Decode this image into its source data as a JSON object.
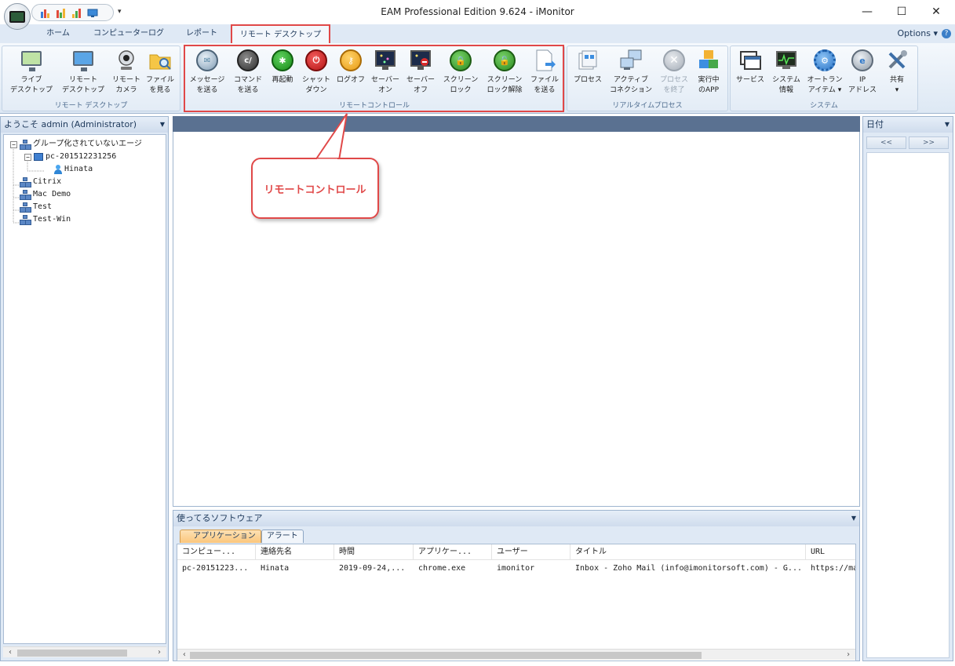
{
  "window": {
    "title": "EAM Professional Edition 9.624 - iMonitor",
    "minimize": "—",
    "maximize": "☐",
    "close": "✕"
  },
  "ribbon_tabs": [
    "ホーム",
    "コンピューターログ",
    "レポート",
    "リモート デスクトップ"
  ],
  "options_label": "Options",
  "help_label": "?",
  "groups": {
    "remote_desktop": {
      "label": "リモート デスクトップ",
      "buttons": [
        "ライブ\nデスクトップ",
        "リモート\nデスクトップ",
        "リモート\nカメラ",
        "ファイル\nを見る"
      ]
    },
    "remote_control": {
      "label": "リモートコントロール",
      "buttons": [
        "メッセージ\nを送る",
        "コマンド\nを送る",
        "再起動",
        "シャット\nダウン",
        "ログオフ",
        "セーバー\nオン",
        "セーバー\nオフ",
        "スクリーン\nロック",
        "スクリーン\nロック解除",
        "ファイル\nを送る"
      ]
    },
    "realtime_process": {
      "label": "リアルタイムプロセス",
      "buttons": [
        "プロセス",
        "アクティブ\nコネクション",
        "プロセス\nを終了",
        "実行中\nのAPP"
      ]
    },
    "system": {
      "label": "システム",
      "buttons": [
        "サービス",
        "システム\n情報",
        "オートラン\nアイテム",
        "IP\nアドレス",
        "共有"
      ]
    }
  },
  "left_panel": {
    "title": "ようこそ admin (Administrator)",
    "tree": {
      "ungrouped": "グループ化されていないエージ",
      "pc": "pc-201512231256",
      "user": "Hinata",
      "groups": [
        "Citrix",
        "Mac Demo",
        "Test",
        "Test-Win"
      ]
    }
  },
  "callout": "リモートコントロール",
  "bottom_panel": {
    "title": "使ってるソフトウェア",
    "tabs": [
      "アプリケーション",
      "アラート"
    ],
    "columns": [
      "コンピュー...",
      "連絡先名",
      "時間",
      "アプリケー...",
      "ユーザー",
      "タイトル",
      "URL"
    ],
    "rows": [
      [
        "pc-20151223...",
        "Hinata",
        "2019-09-24,...",
        "chrome.exe",
        "imonitor",
        "Inbox - Zoho Mail (info@imonitorsoft.com) - G...",
        "https://ma"
      ]
    ]
  },
  "right_panel": {
    "title": "日付",
    "prev": "<<",
    "next": ">>"
  },
  "colors": {
    "highlight": "#e04848",
    "ribbon_bg": "#dfe9f5",
    "panel_header_dark": "#5a7191"
  }
}
